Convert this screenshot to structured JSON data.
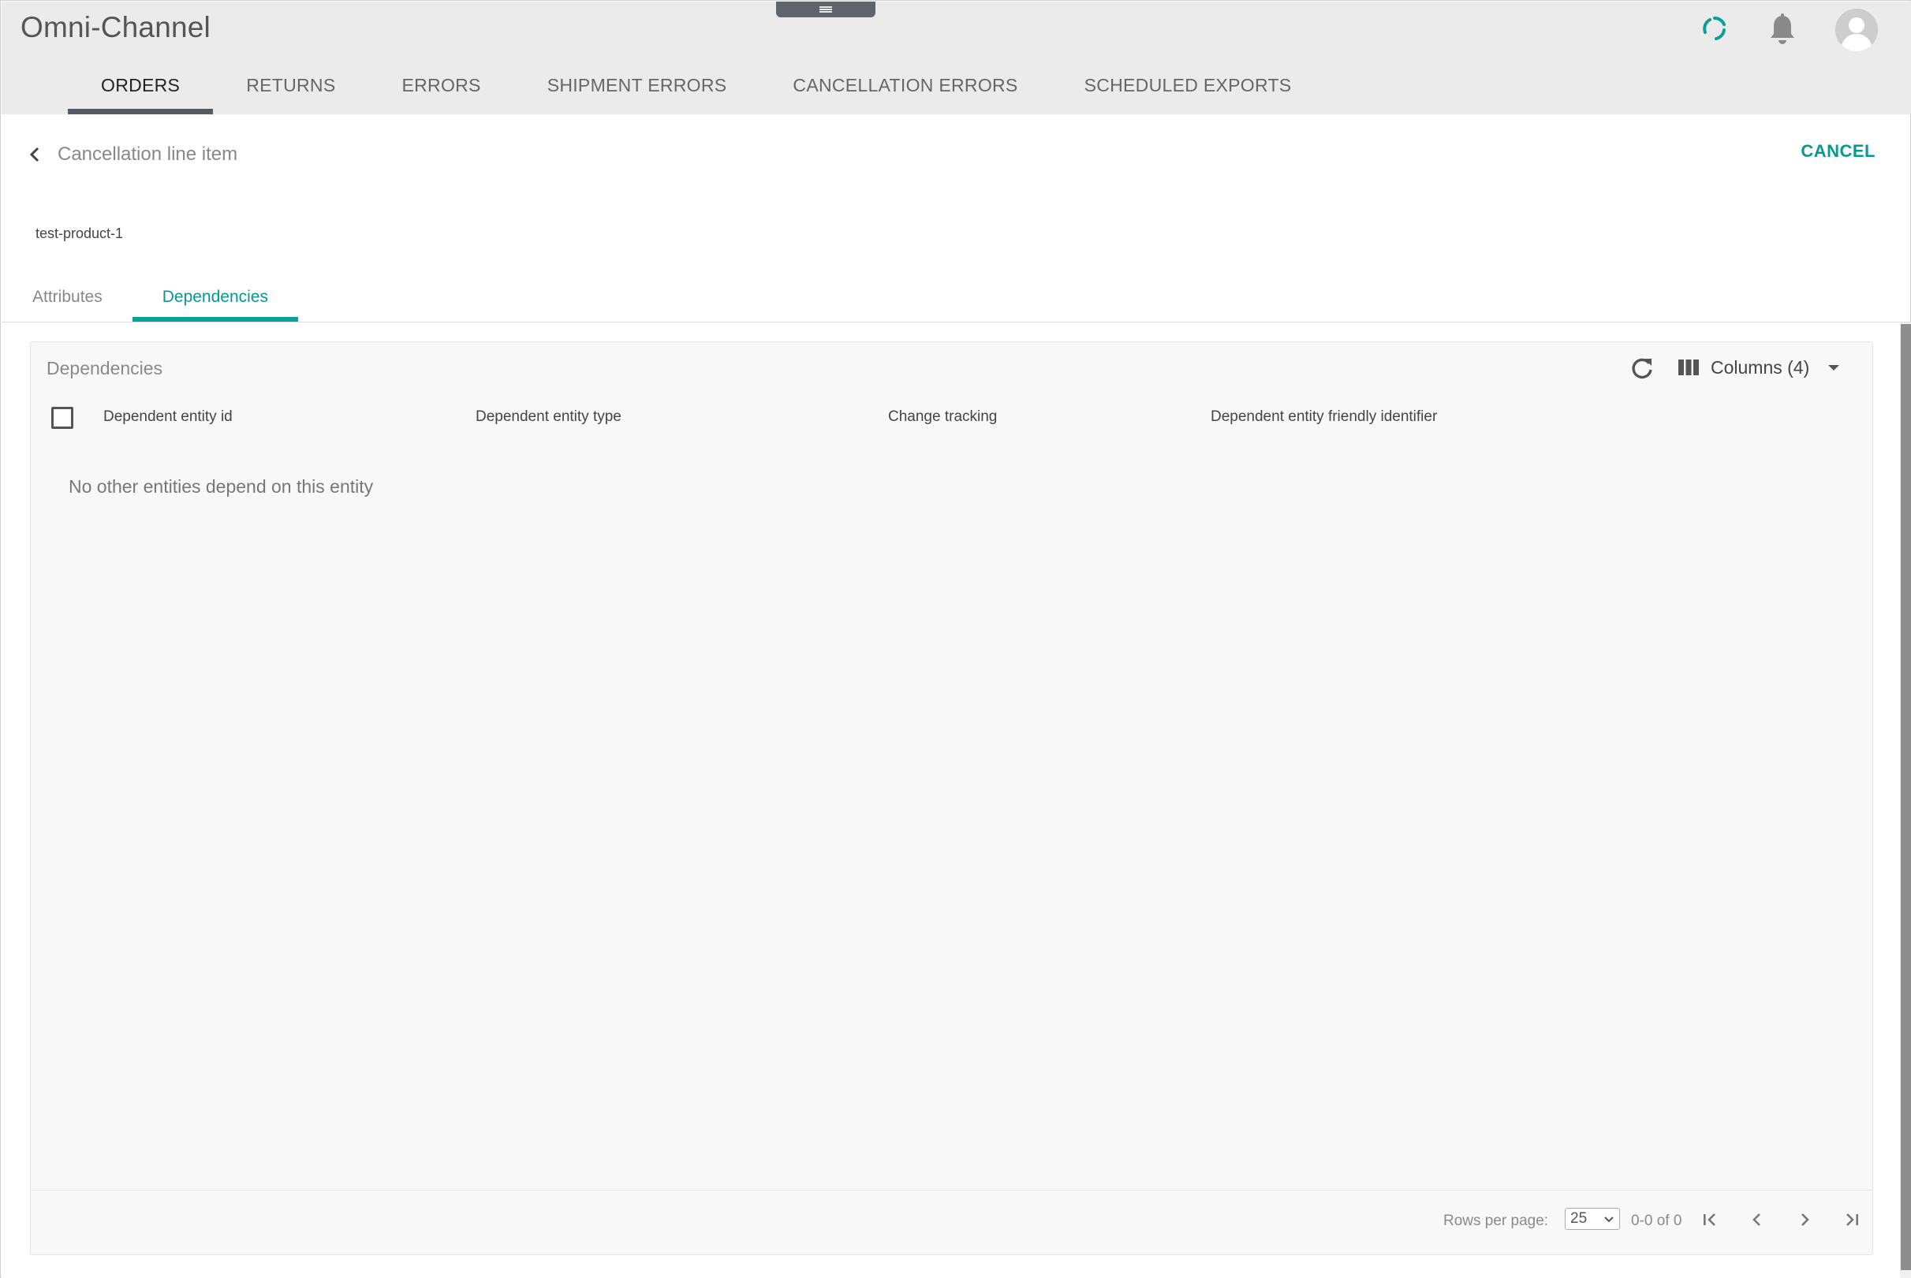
{
  "app": {
    "title": "Omni-Channel"
  },
  "header": {
    "icons": {
      "sync": "sync-icon",
      "notifications": "bell-icon",
      "profile": "avatar-icon"
    },
    "accent_color": "#0aa096"
  },
  "nav": {
    "tabs": [
      {
        "label": "ORDERS",
        "active": true
      },
      {
        "label": "RETURNS"
      },
      {
        "label": "ERRORS"
      },
      {
        "label": "SHIPMENT ERRORS"
      },
      {
        "label": "CANCELLATION ERRORS"
      },
      {
        "label": "SCHEDULED EXPORTS"
      }
    ]
  },
  "detail": {
    "back_label": "Cancellation line item",
    "cancel_label": "CANCEL",
    "product_id": "test-product-1",
    "tabs": [
      {
        "label": "Attributes"
      },
      {
        "label": "Dependencies",
        "active": true
      }
    ]
  },
  "dependencies": {
    "title": "Dependencies",
    "columns_label": "Columns (4)",
    "headers": [
      "Dependent entity id",
      "Dependent entity type",
      "Change tracking",
      "Dependent entity friendly identifier"
    ],
    "empty_message": "No other entities depend on this entity",
    "footer": {
      "rows_per_page_label": "Rows per page:",
      "rows_per_page_value": "25",
      "range": "0-0 of 0"
    }
  }
}
